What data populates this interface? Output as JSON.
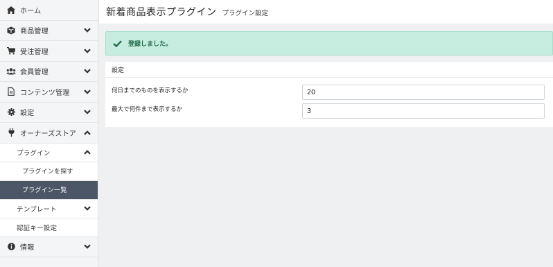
{
  "sidebar": {
    "items": [
      {
        "key": "home",
        "label": "ホーム",
        "icon": "home-icon",
        "chevron": "none"
      },
      {
        "key": "products",
        "label": "商品管理",
        "icon": "cube-icon",
        "chevron": "down"
      },
      {
        "key": "orders",
        "label": "受注管理",
        "icon": "cart-icon",
        "chevron": "down"
      },
      {
        "key": "members",
        "label": "会員管理",
        "icon": "users-icon",
        "chevron": "down"
      },
      {
        "key": "contents",
        "label": "コンテンツ管理",
        "icon": "file-icon",
        "chevron": "down"
      },
      {
        "key": "settings",
        "label": "設定",
        "icon": "gear-icon",
        "chevron": "down"
      },
      {
        "key": "ownerstore",
        "label": "オーナーズストア",
        "icon": "plug-icon",
        "chevron": "up"
      }
    ],
    "plugin_group": {
      "label": "プラグイン",
      "chevron": "up"
    },
    "plugin_search": "プラグインを探す",
    "plugin_list": "プラグイン一覧",
    "template": {
      "label": "テンプレート",
      "chevron": "down"
    },
    "auth_key": "認証キー設定",
    "info": {
      "label": "情報",
      "icon": "info-icon",
      "chevron": "down"
    }
  },
  "header": {
    "title": "新着商品表示プラグイン",
    "subtitle": "プラグイン設定"
  },
  "alert": {
    "message": "登録しました。",
    "color": "#c7ece0"
  },
  "settings_card": {
    "title": "設定",
    "fields": [
      {
        "label": "何日までのものを表示するか",
        "value": "20"
      },
      {
        "label": "最大で何件まで表示するか",
        "value": "3"
      }
    ]
  },
  "colors": {
    "sidebar_bg": "#f4f5f6",
    "active_bg": "#4d5666",
    "alert_text": "#1f6b47"
  }
}
